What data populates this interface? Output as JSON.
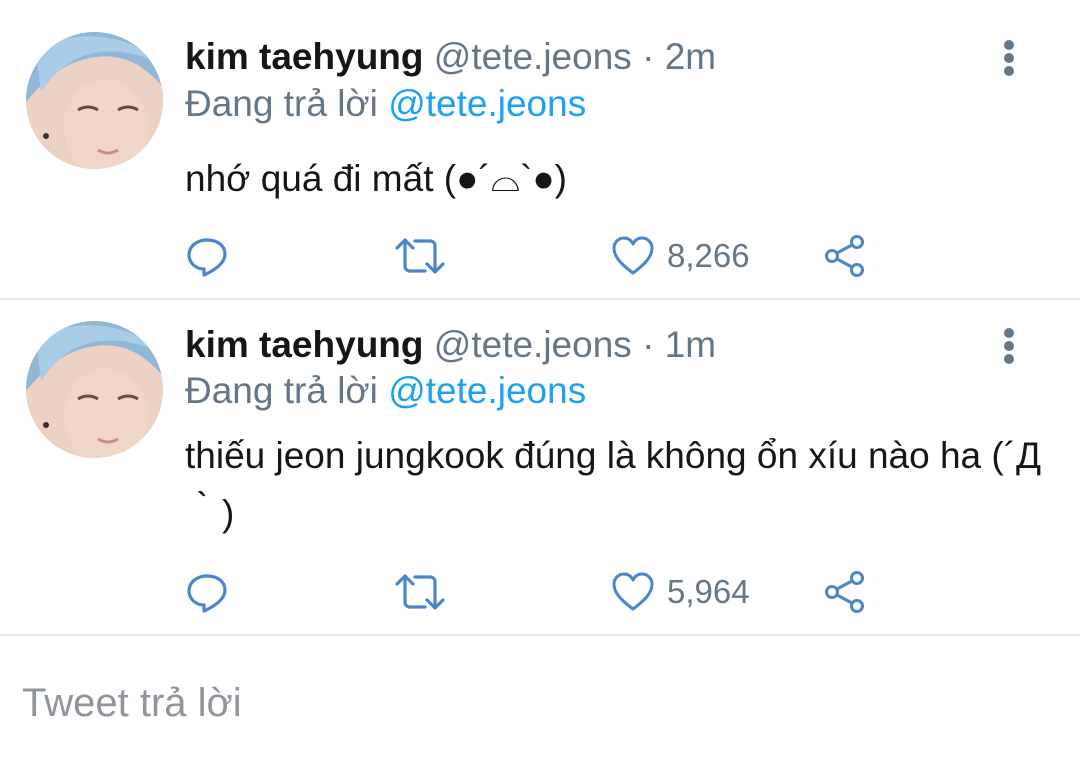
{
  "tweets": [
    {
      "author_name": "kim taehyung",
      "author_handle": "@tete.jeons",
      "separator": "·",
      "time": "2m",
      "reply_prefix": "Đang trả lời",
      "reply_to": "@tete.jeons",
      "text": "nhớ quá đi mất (●´⌓`●)",
      "like_count": "8,266"
    },
    {
      "author_name": "kim taehyung",
      "author_handle": "@tete.jeons",
      "separator": "·",
      "time": "1m",
      "reply_prefix": "Đang trả lời",
      "reply_to": "@tete.jeons",
      "text": "thiếu jeon jungkook đúng là không ổn xíu nào ha (´Д｀)",
      "like_count": "5,964"
    }
  ],
  "composer": {
    "placeholder": "Tweet trả lời"
  },
  "icons": {
    "reply": "reply-icon",
    "retweet": "retweet-icon",
    "like": "heart-icon",
    "share": "share-icon",
    "more": "more-vertical-icon"
  },
  "colors": {
    "accent": "#1da1f2",
    "secondary_text": "#657786",
    "primary_text": "#14171a",
    "divider": "#e1e8ed",
    "icon": "#4a86c8"
  }
}
